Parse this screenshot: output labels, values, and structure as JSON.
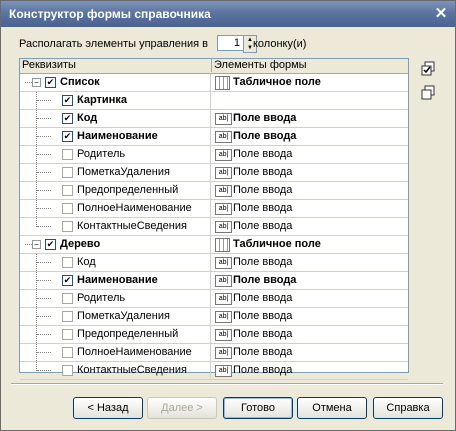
{
  "window": {
    "title": "Конструктор формы справочника",
    "close": "✕"
  },
  "top": {
    "label_before": "Располагать элементы управления в",
    "columns": "1",
    "label_after": "колонку(и)"
  },
  "grid": {
    "col1": "Реквизиты",
    "col2": "Элементы формы",
    "rows": [
      {
        "name": "Список",
        "checked": true,
        "bold": true,
        "elem": "Табличное поле",
        "elem_bold": true,
        "icon": "table-icon"
      },
      {
        "name": "Картинка",
        "checked": true,
        "bold": true,
        "elem": "",
        "elem_bold": false,
        "icon": ""
      },
      {
        "name": "Код",
        "checked": true,
        "bold": true,
        "elem": "Поле ввода",
        "elem_bold": true,
        "icon": "input-icon"
      },
      {
        "name": "Наименование",
        "checked": true,
        "bold": true,
        "elem": "Поле ввода",
        "elem_bold": true,
        "icon": "input-icon"
      },
      {
        "name": "Родитель",
        "checked": false,
        "bold": false,
        "elem": "Поле ввода",
        "elem_bold": false,
        "icon": "input-icon"
      },
      {
        "name": "ПометкаУдаления",
        "checked": false,
        "bold": false,
        "elem": "Поле ввода",
        "elem_bold": false,
        "icon": "input-icon"
      },
      {
        "name": "Предопределенный",
        "checked": false,
        "bold": false,
        "elem": "Поле ввода",
        "elem_bold": false,
        "icon": "input-icon"
      },
      {
        "name": "ПолноеНаименование",
        "checked": false,
        "bold": false,
        "elem": "Поле ввода",
        "elem_bold": false,
        "icon": "input-icon"
      },
      {
        "name": "КонтактныеСведения",
        "checked": false,
        "bold": false,
        "elem": "Поле ввода",
        "elem_bold": false,
        "icon": "input-icon"
      },
      {
        "name": "Дерево",
        "checked": true,
        "bold": true,
        "elem": "Табличное поле",
        "elem_bold": true,
        "icon": "table-icon"
      },
      {
        "name": "Код",
        "checked": false,
        "bold": false,
        "elem": "Поле ввода",
        "elem_bold": false,
        "icon": "input-icon"
      },
      {
        "name": "Наименование",
        "checked": true,
        "bold": true,
        "elem": "Поле ввода",
        "elem_bold": true,
        "icon": "input-icon"
      },
      {
        "name": "Родитель",
        "checked": false,
        "bold": false,
        "elem": "Поле ввода",
        "elem_bold": false,
        "icon": "input-icon"
      },
      {
        "name": "ПометкаУдаления",
        "checked": false,
        "bold": false,
        "elem": "Поле ввода",
        "elem_bold": false,
        "icon": "input-icon"
      },
      {
        "name": "Предопределенный",
        "checked": false,
        "bold": false,
        "elem": "Поле ввода",
        "elem_bold": false,
        "icon": "input-icon"
      },
      {
        "name": "ПолноеНаименование",
        "checked": false,
        "bold": false,
        "elem": "Поле ввода",
        "elem_bold": false,
        "icon": "input-icon"
      },
      {
        "name": "КонтактныеСведения",
        "checked": false,
        "bold": false,
        "elem": "Поле ввода",
        "elem_bold": false,
        "icon": "input-icon"
      }
    ],
    "input_icon_text": "ab|"
  },
  "buttons": {
    "back": "< Назад",
    "next": "Далее >",
    "done": "Готово",
    "cancel": "Отмена",
    "help": "Справка"
  }
}
